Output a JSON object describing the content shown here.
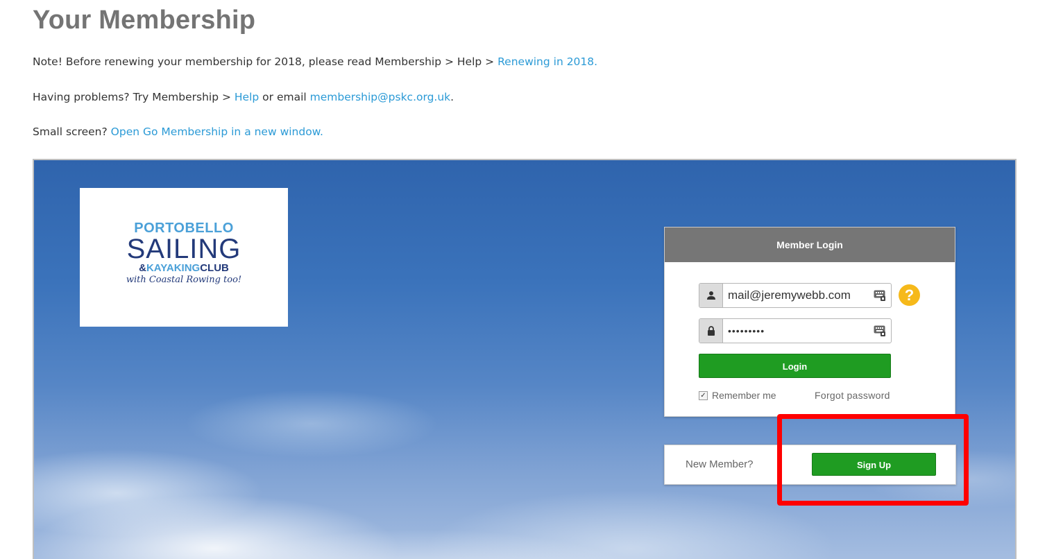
{
  "page": {
    "title": "Your Membership",
    "note_prefix": "Note! Before renewing your membership for 2018, please read Membership > Help > ",
    "note_link": "Renewing in 2018.",
    "problems_prefix": "Having problems? Try Membership > ",
    "problems_help_link": "Help",
    "problems_middle": " or email ",
    "problems_email_link": "membership@pskc.org.uk",
    "problems_suffix": ".",
    "small_screen_prefix": "Small screen? ",
    "small_screen_link": "Open Go Membership in a new window."
  },
  "logo": {
    "line1": "PORTOBELLO",
    "line2": "SAILING",
    "line3a": "&",
    "line3b": "KAYAKING",
    "line3c": "CLUB",
    "line4": "with Coastal Rowing too!"
  },
  "login": {
    "header": "Member Login",
    "username_value": "mail@jeremywebb.com",
    "password_value": "•••••••••",
    "help_symbol": "?",
    "login_button": "Login",
    "remember_label": "Remember me",
    "remember_checked": true,
    "forgot_label": "Forgot password"
  },
  "signup": {
    "prompt": "New Member?",
    "button": "Sign Up"
  },
  "colors": {
    "title": "#747474",
    "link": "#2b9ad6",
    "header_bg": "#767676",
    "button_green": "#1f9c22",
    "help_yellow": "#f6b91a",
    "highlight": "#ff0000"
  },
  "icons": {
    "user": "user-icon",
    "lock": "lock-icon",
    "keyboard": "keyboard-icon",
    "help": "help-icon"
  }
}
